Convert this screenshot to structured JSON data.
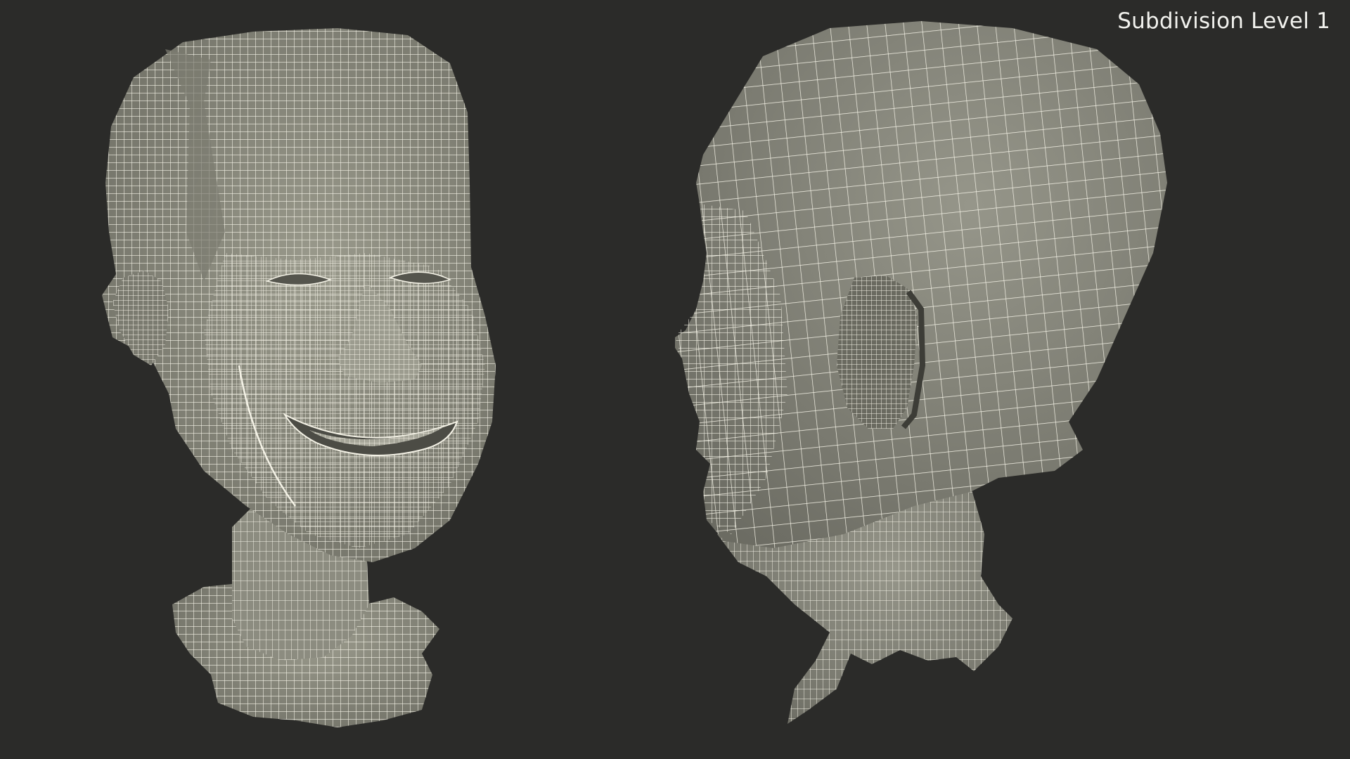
{
  "viewport": {
    "background": "#2b2b29",
    "mesh_fill": "#8a8a7d",
    "mesh_shadow": "#5e5e55",
    "wire_color": "#f4f2e6"
  },
  "overlay": {
    "label": "Subdivision Level 1"
  },
  "models": [
    {
      "name": "head-front-view"
    },
    {
      "name": "head-side-view"
    }
  ]
}
